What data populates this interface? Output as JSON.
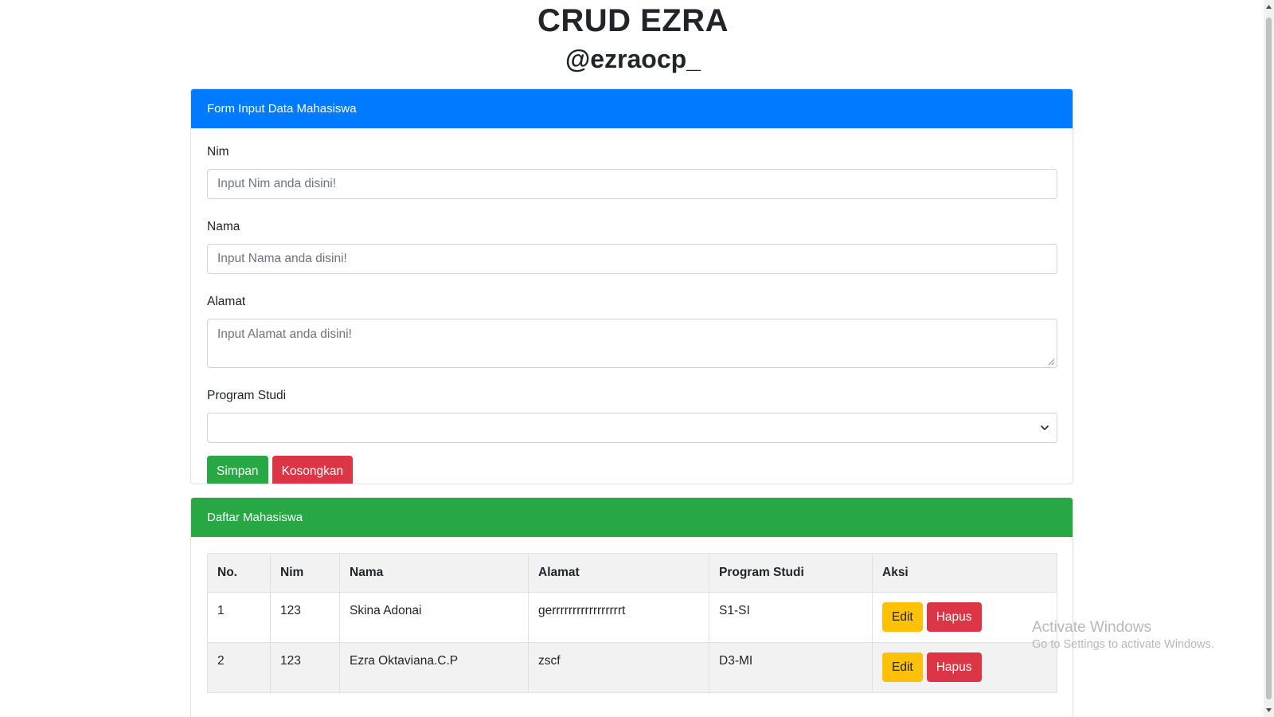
{
  "page": {
    "title": "CRUD EZRA",
    "subtitle": "@ezraocp_"
  },
  "form": {
    "header": "Form Input Data Mahasiswa",
    "nim": {
      "label": "Nim",
      "placeholder": "Input Nim anda disini!"
    },
    "nama": {
      "label": "Nama",
      "placeholder": "Input Nama anda disini!"
    },
    "alamat": {
      "label": "Alamat",
      "placeholder": "Input Alamat anda disini!"
    },
    "program_studi": {
      "label": "Program Studi",
      "selected": ""
    },
    "save_label": "Simpan",
    "clear_label": "Kosongkan",
    "colors": {
      "header": "#007bff",
      "save": "#28a745",
      "clear": "#dc3545"
    }
  },
  "list": {
    "header": "Daftar Mahasiswa",
    "columns": [
      "No.",
      "Nim",
      "Nama",
      "Alamat",
      "Program Studi",
      "Aksi"
    ],
    "rows": [
      {
        "no": "1",
        "nim": "123",
        "nama": "Skina Adonai",
        "alamat": "gerrrrrrrrrrrrrrrrrt",
        "prodi": "S1-SI",
        "edit": "Edit",
        "hapus": "Hapus"
      },
      {
        "no": "2",
        "nim": "123",
        "nama": "Ezra Oktaviana.C.P",
        "alamat": "zscf",
        "prodi": "D3-MI",
        "edit": "Edit",
        "hapus": "Hapus"
      }
    ],
    "colors": {
      "header": "#28a745",
      "edit": "#ffc107",
      "hapus": "#dc3545"
    }
  },
  "watermark": {
    "title": "Activate Windows",
    "subtitle": "Go to Settings to activate Windows."
  }
}
